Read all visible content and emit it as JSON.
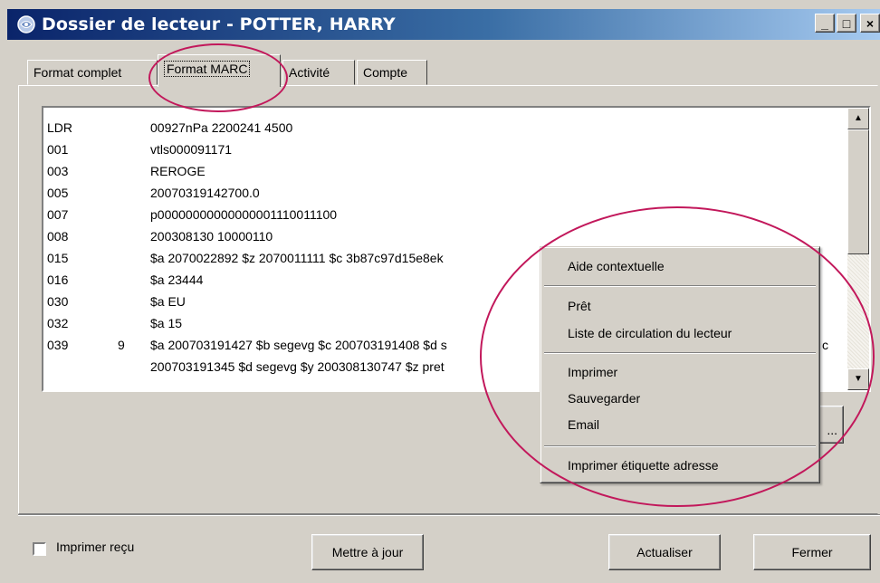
{
  "window": {
    "title": "Dossier de lecteur - POTTER, HARRY",
    "minimize_glyph": "_",
    "maximize_glyph": "□",
    "close_glyph": "×"
  },
  "tabs": [
    {
      "label": "Format complet"
    },
    {
      "label": "Format MARC"
    },
    {
      "label": "Activité"
    },
    {
      "label": "Compte"
    }
  ],
  "marc": {
    "rows": [
      {
        "tag": "LDR",
        "ind": "",
        "value": "00927nPa  2200241   4500"
      },
      {
        "tag": "001",
        "ind": "",
        "value": "vtls000091171"
      },
      {
        "tag": "003",
        "ind": "",
        "value": "REROGE"
      },
      {
        "tag": "005",
        "ind": "",
        "value": "20070319142700.0"
      },
      {
        "tag": "007",
        "ind": "",
        "value": "p00000000000000001110011100"
      },
      {
        "tag": "008",
        "ind": "",
        "value": "200308130 10000110"
      },
      {
        "tag": "015",
        "ind": "",
        "value": "$a 2070022892 $z 2070011111 $c 3b87c97d15e8ek"
      },
      {
        "tag": "016",
        "ind": "",
        "value": "$a 23444"
      },
      {
        "tag": "030",
        "ind": "",
        "value": "$a EU"
      },
      {
        "tag": "032",
        "ind": "",
        "value": "$a 15"
      },
      {
        "tag": "039",
        "ind": "9",
        "value": "$a 200703191427 $b segevg $c 200703191408 $d s"
      },
      {
        "tag": "",
        "ind": "",
        "value": "200703191345 $d segevg $y 200308130747 $z pret"
      }
    ],
    "cut_off_fragment": "c",
    "scroll_up_glyph": "▲",
    "scroll_down_glyph": "▼"
  },
  "partial_button_label": "...",
  "context_menu": {
    "items": [
      {
        "label": "Aide contextuelle"
      },
      {
        "label": "Prêt"
      },
      {
        "label": "Liste de circulation du lecteur"
      },
      {
        "label": "Imprimer"
      },
      {
        "label": "Sauvegarder"
      },
      {
        "label": "Email"
      },
      {
        "label": "Imprimer étiquette adresse"
      }
    ]
  },
  "footer": {
    "print_receipt_label": "Imprimer reçu",
    "print_receipt_checked": false,
    "update_button": "Mettre à jour",
    "refresh_button": "Actualiser",
    "close_button": "Fermer"
  },
  "annotation_color": "#c2185b"
}
